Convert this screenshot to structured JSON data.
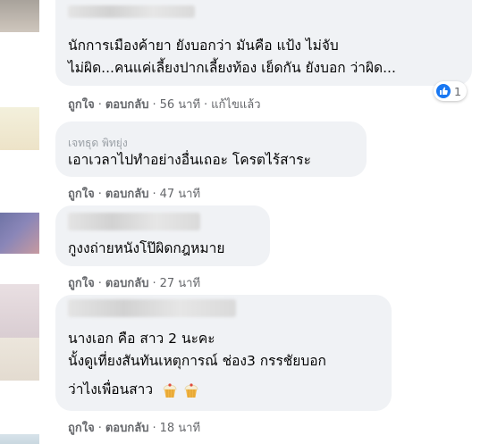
{
  "comments": [
    {
      "lines": [
        "นักการเมืองค้ายา ยังบอกว่า มันคือ แป้ง ไม่จับ",
        "ไม่ผิด...คนแค่เลี้ยงปากเลี้ยงท้อง เย็ดกัน ยังบอก ว่าผิด..."
      ],
      "like": "ถูกใจ",
      "reply": "ตอบกลับ",
      "time": "56 นาที",
      "edited": "แก้ไขแล้ว",
      "reaction_count": "1"
    },
    {
      "author_fragment": "เจทธุด พิทยุ่ง",
      "lines": [
        "เอาเวลาไปทำอย่างอื่นเถอะ โครตไร้สาระ"
      ],
      "like": "ถูกใจ",
      "reply": "ตอบกลับ",
      "time": "47 นาที"
    },
    {
      "lines": [
        "กูงงถ่ายหนังโป๊ผิดกฎหมาย"
      ],
      "like": "ถูกใจ",
      "reply": "ตอบกลับ",
      "time": "27 นาที"
    },
    {
      "lines": [
        "นางเอก คือ สาว 2 นะคะ",
        "นั้งดูเที่ยงสันทันเหตุการณ์ ช่อง3 กรรชัยบอก",
        "ว่าไงเพื่อนสาว"
      ],
      "like": "ถูกใจ",
      "reply": "ตอบกลับ",
      "time": "18 นาที"
    }
  ],
  "colors": {
    "bubble": "#f0f2f5",
    "action_text": "#65676b",
    "like_blue": "#1877f2"
  },
  "icons": {
    "reaction": "like-icon",
    "emoji": "cupcake-emoji"
  }
}
